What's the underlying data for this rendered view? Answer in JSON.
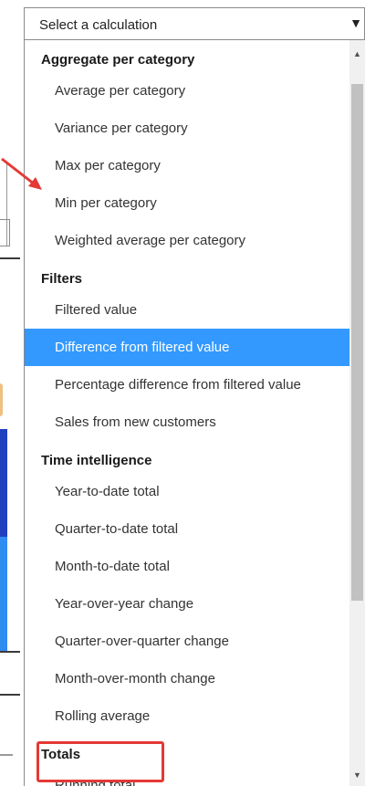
{
  "select": {
    "placeholder": "Select a calculation"
  },
  "icons": {
    "dropdown_arrow": "▼",
    "scroll_up": "▲",
    "scroll_down": "▼"
  },
  "groups": [
    {
      "header": "Aggregate per category",
      "items": [
        "Average per category",
        "Variance per category",
        "Max per category",
        "Min per category",
        "Weighted average per category"
      ]
    },
    {
      "header": "Filters",
      "items": [
        "Filtered value",
        "Difference from filtered value",
        "Percentage difference from filtered value",
        "Sales from new customers"
      ]
    },
    {
      "header": "Time intelligence",
      "items": [
        "Year-to-date total",
        "Quarter-to-date total",
        "Month-to-date total",
        "Year-over-year change",
        "Quarter-over-quarter change",
        "Month-over-month change",
        "Rolling average"
      ]
    },
    {
      "header": "Totals",
      "items": [
        "Running total"
      ]
    }
  ],
  "selected_item": "Difference from filtered value",
  "highlighted_item": "Running total",
  "colors": {
    "selected_bg": "#3399ff",
    "highlight_border": "#e53935",
    "arrow": "#e53935"
  }
}
